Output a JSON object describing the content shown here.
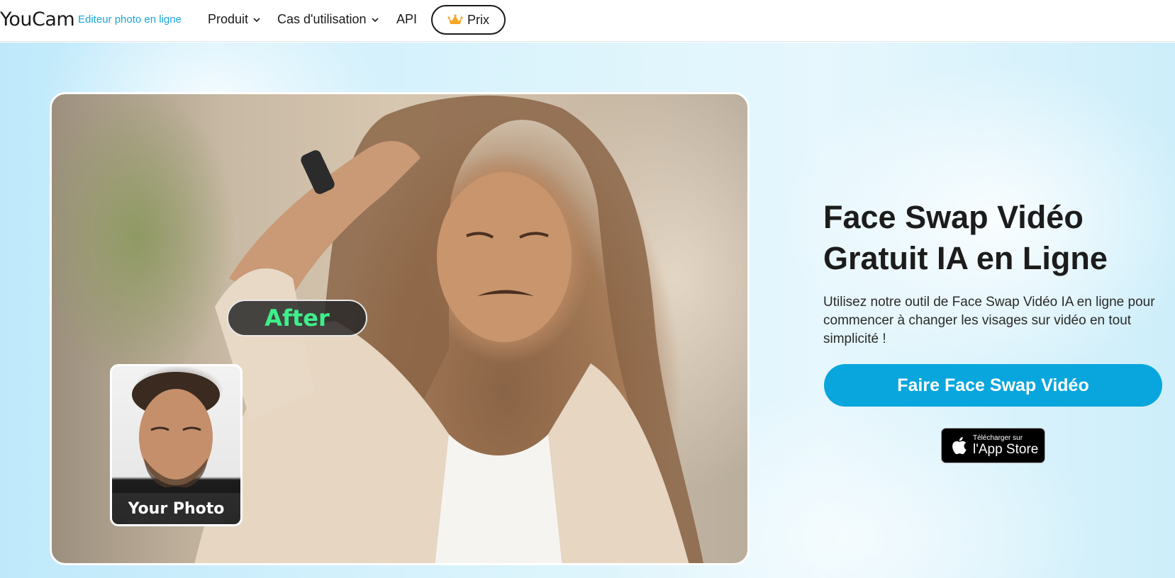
{
  "header": {
    "logo": "YouCam",
    "logo_subtitle": "Editeur photo en ligne",
    "nav": {
      "produit": "Produit",
      "cas": "Cas d'utilisation",
      "api": "API",
      "prix": "Prix"
    }
  },
  "hero": {
    "after_label": "After",
    "your_photo_label": "Your Photo",
    "headline_line1": "Face Swap Vidéo",
    "headline_line2": "Gratuit IA en Ligne",
    "description": "Utilisez notre outil de Face Swap Vidéo IA en ligne pour commencer à changer les visages sur vidéo en tout simplicité !",
    "cta_label": "Faire Face Swap Vidéo",
    "appstore_small": "Télécharger sur",
    "appstore_big": "l'App Store"
  },
  "colors": {
    "accent": "#08a6dd",
    "after_text": "#3df08a",
    "logo_subtitle": "#1aa6d8"
  }
}
